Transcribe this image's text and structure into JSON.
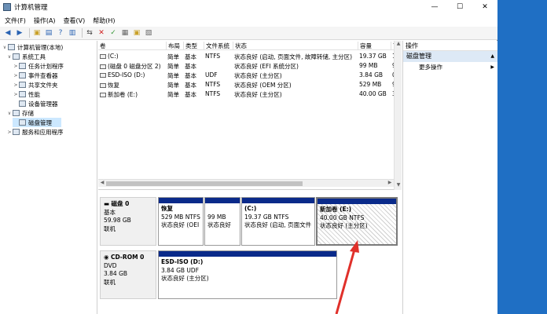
{
  "window": {
    "title": "计算机管理",
    "min": "—",
    "max": "☐",
    "close": "✕"
  },
  "menu": [
    "文件(F)",
    "操作(A)",
    "查看(V)",
    "帮助(H)"
  ],
  "tree": [
    {
      "label": "计算机管理(本地)",
      "expand": "∨"
    },
    {
      "label": "系统工具",
      "expand": "∨"
    },
    {
      "label": "任务计划程序",
      "expand": ">"
    },
    {
      "label": "事件查看器",
      "expand": ">"
    },
    {
      "label": "共享文件夹",
      "expand": ">"
    },
    {
      "label": "性能",
      "expand": ">"
    },
    {
      "label": "设备管理器",
      "expand": ""
    },
    {
      "label": "存储",
      "expand": "∨"
    },
    {
      "label": "磁盘管理",
      "expand": "",
      "selected": true
    },
    {
      "label": "服务和应用程序",
      "expand": ">"
    }
  ],
  "columns": [
    "卷",
    "布局",
    "类型",
    "文件系统",
    "状态",
    "容量",
    "可"
  ],
  "volumes": [
    {
      "name": "(C:)",
      "layout": "简单",
      "type": "基本",
      "fs": "NTFS",
      "status": "状态良好 (启动, 页面文件, 故障转储, 主分区)",
      "size": "19.37 GB",
      "free": "1"
    },
    {
      "name": "(磁盘 0 磁盘分区 2)",
      "layout": "简单",
      "type": "基本",
      "fs": "",
      "status": "状态良好 (EFI 系统分区)",
      "size": "99 MB",
      "free": "9"
    },
    {
      "name": "ESD-ISO (D:)",
      "layout": "简单",
      "type": "基本",
      "fs": "UDF",
      "status": "状态良好 (主分区)",
      "size": "3.84 GB",
      "free": "0"
    },
    {
      "name": "恢复",
      "layout": "简单",
      "type": "基本",
      "fs": "NTFS",
      "status": "状态良好 (OEM 分区)",
      "size": "529 MB",
      "free": "9"
    },
    {
      "name": "新加卷 (E:)",
      "layout": "简单",
      "type": "基本",
      "fs": "NTFS",
      "status": "状态良好 (主分区)",
      "size": "40.00 GB",
      "free": "3"
    }
  ],
  "disk0": {
    "name": "磁盘 0",
    "type": "基本",
    "size": "59.98 GB",
    "state": "联机",
    "parts": [
      {
        "title": "恢复",
        "size": "529 MB NTFS",
        "status": "状态良好 (OEI"
      },
      {
        "title": "",
        "size": "99 MB",
        "status": "状态良好"
      },
      {
        "title": "(C:)",
        "size": "19.37 GB NTFS",
        "status": "状态良好 (启动, 页面文件"
      },
      {
        "title": "新加卷 (E:)",
        "size": "40.00 GB NTFS",
        "status": "状态良好 (主分区)"
      }
    ]
  },
  "cdrom": {
    "name": "CD-ROM 0",
    "type": "DVD",
    "size": "3.84 GB",
    "state": "联机",
    "part": {
      "title": "ESD-ISO (D:)",
      "size": "3.84 GB UDF",
      "status": "状态良好 (主分区)"
    }
  },
  "actions": {
    "header": "操作",
    "section": "磁盘管理",
    "more": "更多操作"
  },
  "colors": {
    "partition_bar": "#0a2a8a",
    "arrow": "#e0302a",
    "desktop": "#1f6fc4"
  }
}
